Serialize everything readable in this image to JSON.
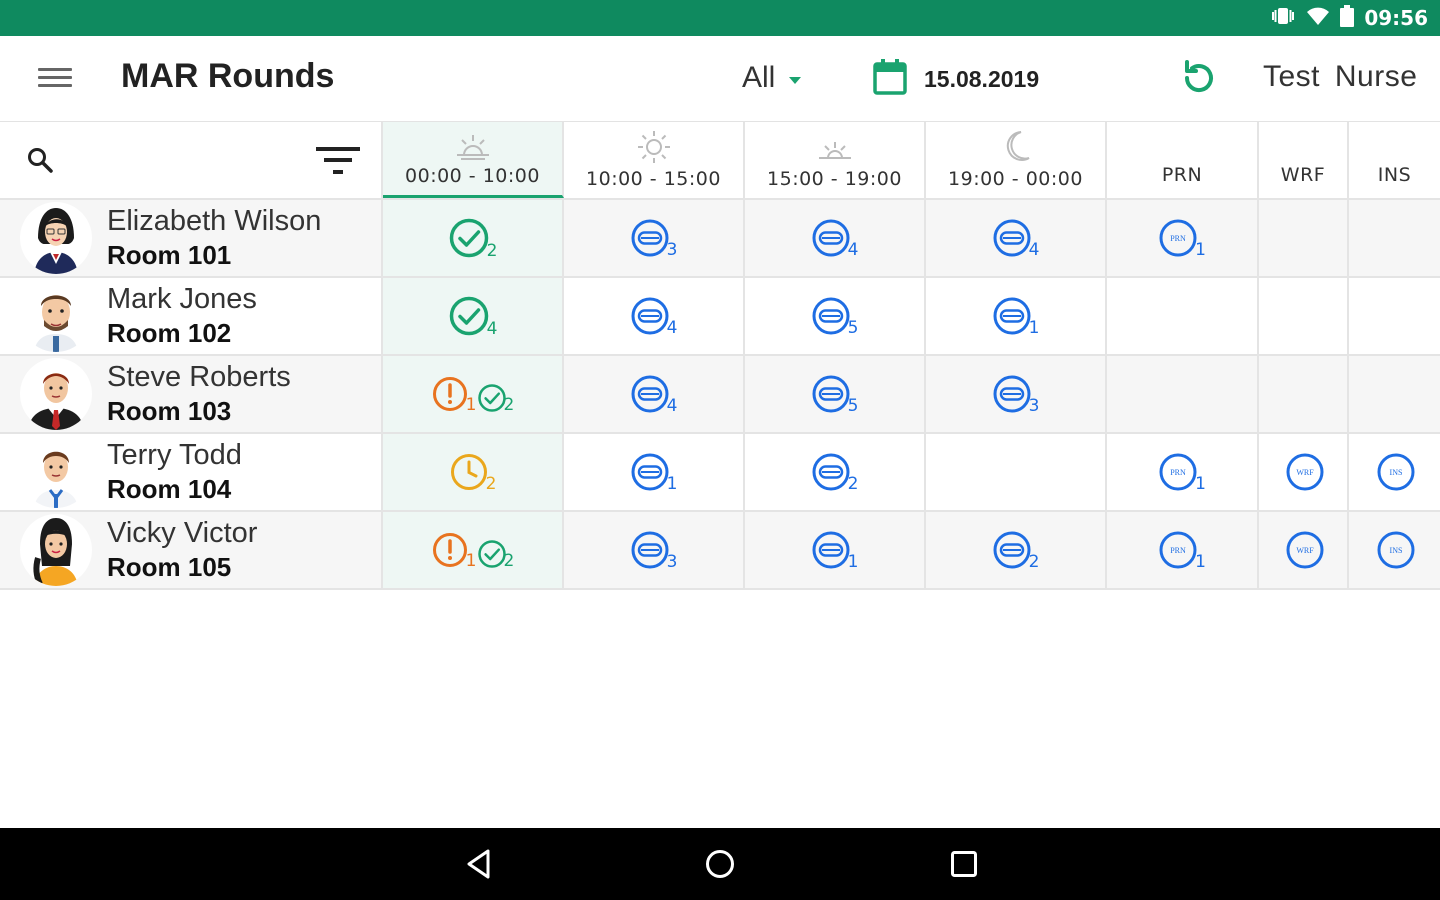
{
  "status_bar": {
    "time": "09:56"
  },
  "app_bar": {
    "title": "MAR Rounds",
    "filter_value": "All",
    "date": "15.08.2019",
    "user": "Test Nurse"
  },
  "columns": [
    {
      "label": "00:00 - 10:00",
      "icon": "sunrise-icon"
    },
    {
      "label": "10:00 - 15:00",
      "icon": "sun-icon"
    },
    {
      "label": "15:00 - 19:00",
      "icon": "sunset-icon"
    },
    {
      "label": "19:00 - 00:00",
      "icon": "moon-icon"
    },
    {
      "label": "PRN"
    },
    {
      "label": "WRF"
    },
    {
      "label": "INS"
    }
  ],
  "patients": [
    {
      "name": "Elizabeth Wilson",
      "room": "Room 101",
      "cells": [
        [
          {
            "icon": "check-circle-icon",
            "count": "2",
            "color": "green"
          }
        ],
        [
          {
            "icon": "pill-icon",
            "count": "3",
            "color": "blue"
          }
        ],
        [
          {
            "icon": "pill-icon",
            "count": "4",
            "color": "blue"
          }
        ],
        [
          {
            "icon": "pill-icon",
            "count": "4",
            "color": "blue"
          }
        ],
        [
          {
            "icon": "prn-icon",
            "count": "1",
            "color": "blue"
          }
        ],
        [],
        []
      ]
    },
    {
      "name": "Mark Jones",
      "room": "Room 102",
      "cells": [
        [
          {
            "icon": "check-circle-icon",
            "count": "4",
            "color": "green"
          }
        ],
        [
          {
            "icon": "pill-icon",
            "count": "4",
            "color": "blue"
          }
        ],
        [
          {
            "icon": "pill-icon",
            "count": "5",
            "color": "blue"
          }
        ],
        [
          {
            "icon": "pill-icon",
            "count": "1",
            "color": "blue"
          }
        ],
        [],
        [],
        []
      ]
    },
    {
      "name": "Steve Roberts",
      "room": "Room 103",
      "cells": [
        [
          {
            "icon": "alert-circle-icon",
            "count": "1",
            "color": "orange"
          },
          {
            "icon": "check-circle-small-icon",
            "count": "2",
            "color": "green"
          }
        ],
        [
          {
            "icon": "pill-icon",
            "count": "4",
            "color": "blue"
          }
        ],
        [
          {
            "icon": "pill-icon",
            "count": "5",
            "color": "blue"
          }
        ],
        [
          {
            "icon": "pill-icon",
            "count": "3",
            "color": "blue"
          }
        ],
        [],
        [],
        []
      ]
    },
    {
      "name": "Terry Todd",
      "room": "Room 104",
      "cells": [
        [
          {
            "icon": "clock-icon",
            "count": "2",
            "color": "amber"
          }
        ],
        [
          {
            "icon": "pill-icon",
            "count": "1",
            "color": "blue"
          }
        ],
        [
          {
            "icon": "pill-icon",
            "count": "2",
            "color": "blue"
          }
        ],
        [],
        [
          {
            "icon": "prn-icon",
            "count": "1",
            "color": "blue"
          }
        ],
        [
          {
            "icon": "wrf-icon",
            "count": "",
            "color": "blue"
          }
        ],
        [
          {
            "icon": "ins-icon",
            "count": "",
            "color": "blue"
          }
        ]
      ]
    },
    {
      "name": "Vicky Victor",
      "room": "Room 105",
      "cells": [
        [
          {
            "icon": "alert-circle-icon",
            "count": "1",
            "color": "orange"
          },
          {
            "icon": "check-circle-small-icon",
            "count": "2",
            "color": "green"
          }
        ],
        [
          {
            "icon": "pill-icon",
            "count": "3",
            "color": "blue"
          }
        ],
        [
          {
            "icon": "pill-icon",
            "count": "1",
            "color": "blue"
          }
        ],
        [
          {
            "icon": "pill-icon",
            "count": "2",
            "color": "blue"
          }
        ],
        [
          {
            "icon": "prn-icon",
            "count": "1",
            "color": "blue"
          }
        ],
        [
          {
            "icon": "wrf-icon",
            "count": "",
            "color": "blue"
          }
        ],
        [
          {
            "icon": "ins-icon",
            "count": "",
            "color": "blue"
          }
        ]
      ]
    }
  ],
  "colors": {
    "status_bar": "#0f8a5f",
    "accent_green": "#1aa36f",
    "blue": "#1e6de3",
    "orange": "#e8731f",
    "amber": "#eaa71c",
    "highlight_column": "#eef7f4"
  }
}
